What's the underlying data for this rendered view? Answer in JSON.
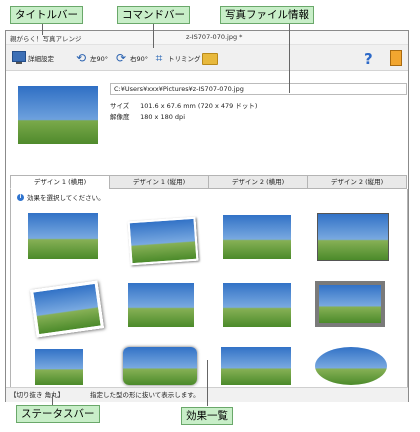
{
  "callouts": {
    "titlebar": "タイトルバー",
    "commandbar": "コマンドバー",
    "fileinfo": "写真ファイル情報",
    "statusbar": "ステータスバー",
    "effects": "効果一覧"
  },
  "window": {
    "title_left": "親がらく！写真アレンジ",
    "title_center": "z-IS707-070.jpg *"
  },
  "toolbar": {
    "detail_settings": "詳細設定",
    "rotate_left": "左90°",
    "rotate_right": "右90°",
    "trim": "トリミング"
  },
  "file": {
    "path": "C:¥Users¥xxx¥Pictures¥z-IS707-070.jpg",
    "size_label": "サイズ",
    "size_value": "101.6 x 67.6 mm (720 x 479 ドット)",
    "resolution_label": "解像度",
    "resolution_value": "180 x 180 dpi"
  },
  "tabs": [
    {
      "label": "デザイン 1 (横用)"
    },
    {
      "label": "デザイン 1 (縦用)"
    },
    {
      "label": "デザイン 2 (横用)"
    },
    {
      "label": "デザイン 2 (縦用)"
    }
  ],
  "hint": "効果を選択してください。",
  "status": {
    "left": "【切り抜き 角丸】",
    "right": "指定した型の形に抜いて表示します。"
  }
}
